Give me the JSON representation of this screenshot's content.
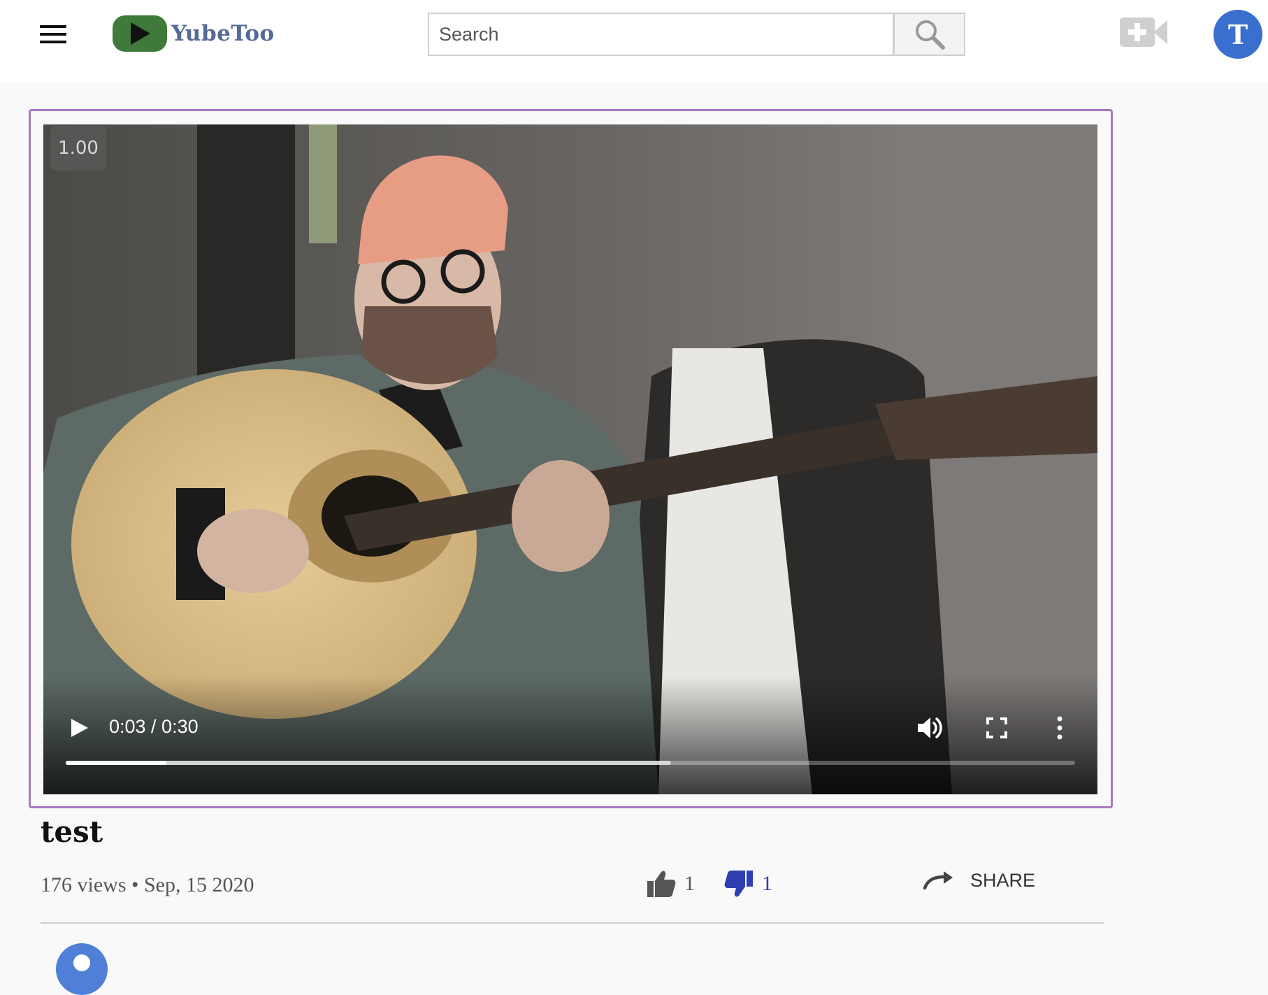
{
  "header": {
    "logo_text": "YubeToo",
    "search_placeholder": "Search",
    "avatar_initial": "T"
  },
  "player": {
    "playback_speed": "1.00",
    "time_display": "0:03 / 0:30",
    "progress_fraction": 0.1,
    "buffered_fraction": 0.6,
    "frame_border_color": "#a977bd"
  },
  "video": {
    "title": "test",
    "meta": "176 views • Sep, 15 2020",
    "likes": "1",
    "dislikes": "1",
    "share_label": "SHARE"
  },
  "colors": {
    "logo_green": "#3f7a3a",
    "logo_text": "#566a98",
    "avatar_blue": "#3a6fd0",
    "dislike_active": "#2d3fb0"
  }
}
